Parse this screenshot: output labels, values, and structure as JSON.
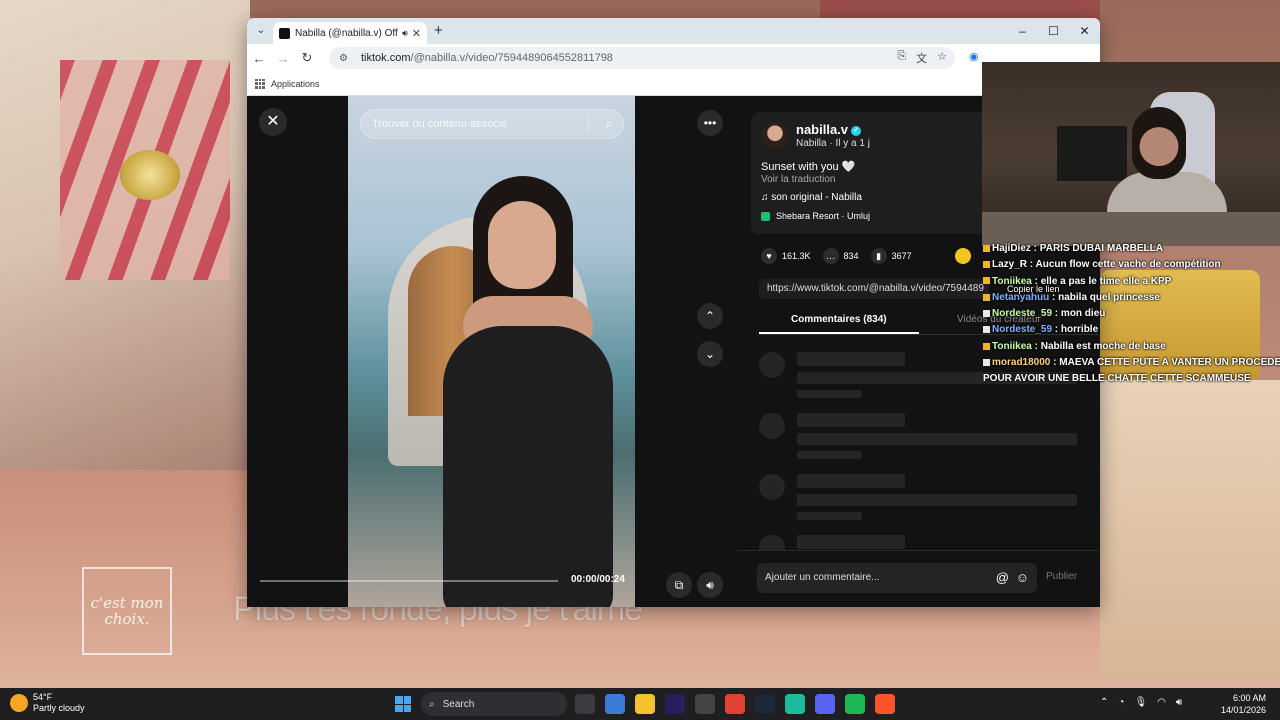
{
  "browser": {
    "tab_title": "Nabilla (@nabilla.v) Officie",
    "url_host": "tiktok.com",
    "url_path": "/@nabilla.v/video/7594489064552811798",
    "bookmarks_label": "Applications",
    "window_controls": [
      "–",
      "☐",
      "✕"
    ]
  },
  "video": {
    "search_placeholder": "Trouver du contenu associé",
    "time": "00:00/00:24"
  },
  "post": {
    "username": "nabilla.v",
    "display_meta": "Nabilla · Il y a 1 j",
    "caption": "Sunset with you 🤍",
    "translate": "Voir la traduction",
    "sound": "♫  son original - Nabilla",
    "location": "Shebara Resort · Umluj",
    "likes": "161.3K",
    "comments": "834",
    "saves": "3677",
    "link": "https://www.tiktok.com/@nabilla.v/video/7594489",
    "tab_comments": "Commentaires (834)",
    "tab_creator": "Vidéos du créateur",
    "comment_placeholder": "Ajouter un commentaire...",
    "publish": "Publier"
  },
  "stream": {
    "logo_text": "c'est mon choix.",
    "subtitle": "Plus t'es ronde, plus je t'aime",
    "copy_link": "Copier le lien"
  },
  "chat": [
    {
      "user": "HajiDiez",
      "text": "PARIS DUBAI MARBELLA",
      "color": "#ffffff"
    },
    {
      "user": "Lazy_R",
      "text": "Aucun flow cette vache de compétition",
      "color": "#ffffff"
    },
    {
      "user": "Toniikea",
      "text": "elle a pas le time elle a KPP",
      "color": "#c8ff9e"
    },
    {
      "user": "Netanyahuu",
      "text": "nabila quel princesse",
      "color": "#7fb0ff"
    },
    {
      "user": "Nordeste_59",
      "text": "mon dieu",
      "color": "#c8ff9e"
    },
    {
      "user": "Nordeste_59",
      "text": "horrible",
      "color": "#7fb0ff"
    },
    {
      "user": "Toniikea",
      "text": "Nabilla est moche de base",
      "color": "#c8ff9e"
    },
    {
      "user": "morad18000",
      "text": "MAEVA CETTE PUTE A VANTER UN PROCEDER",
      "color": "#ffd27f"
    },
    {
      "user": "",
      "text": "POUR AVOIR UNE BELLE CHATTE CETTE SCAMMEUSE",
      "color": "#ffffff"
    }
  ],
  "taskbar": {
    "temp": "54°F",
    "weather": "Partly cloudy",
    "search": "Search",
    "time": "6:00 AM",
    "date": "14/01/2026"
  }
}
